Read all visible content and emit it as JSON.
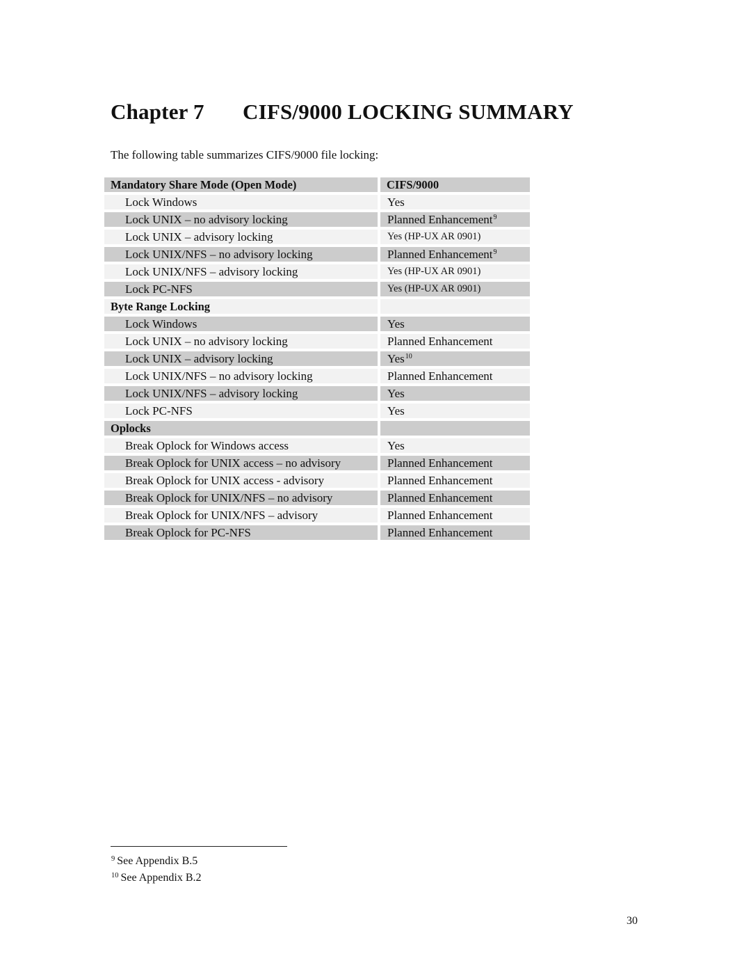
{
  "chapter": {
    "label": "Chapter 7",
    "title": "CIFS/9000 LOCKING SUMMARY"
  },
  "intro": "The following table summarizes CIFS/9000 file locking:",
  "table": {
    "header": {
      "feature": "Mandatory Share Mode (Open Mode)",
      "value": "CIFS/9000"
    },
    "rows": [
      {
        "feature": "Lock Windows",
        "value": "Yes",
        "note": ""
      },
      {
        "feature": "Lock UNIX – no advisory locking",
        "value": "Planned Enhancement",
        "note": "9"
      },
      {
        "feature": "Lock UNIX – advisory locking",
        "value": "Yes (HP-UX AR 0901)",
        "note": ""
      },
      {
        "feature": "Lock UNIX/NFS – no advisory locking",
        "value": "Planned Enhancement",
        "note": "9"
      },
      {
        "feature": "Lock UNIX/NFS – advisory locking",
        "value": "Yes (HP-UX AR 0901)",
        "note": ""
      },
      {
        "feature": "Lock PC-NFS",
        "value": "Yes (HP-UX AR 0901)",
        "note": ""
      },
      {
        "section": "Byte Range Locking"
      },
      {
        "feature": "Lock Windows",
        "value": "Yes",
        "note": ""
      },
      {
        "feature": "Lock UNIX – no advisory locking",
        "value": "Planned Enhancement",
        "note": ""
      },
      {
        "feature": "Lock UNIX – advisory locking",
        "value": "Yes",
        "note": "10"
      },
      {
        "feature": "Lock UNIX/NFS – no advisory locking",
        "value": "Planned Enhancement",
        "note": ""
      },
      {
        "feature": "Lock UNIX/NFS – advisory locking",
        "value": "Yes",
        "note": ""
      },
      {
        "feature": "Lock PC-NFS",
        "value": "Yes",
        "note": ""
      },
      {
        "section": "Oplocks"
      },
      {
        "feature": "Break Oplock for Windows access",
        "value": "Yes",
        "note": ""
      },
      {
        "feature": "Break Oplock for UNIX access – no advisory",
        "value": "Planned Enhancement",
        "note": ""
      },
      {
        "feature": "Break Oplock for UNIX access - advisory",
        "value": "Planned Enhancement",
        "note": ""
      },
      {
        "feature": "Break Oplock for UNIX/NFS – no advisory",
        "value": "Planned Enhancement",
        "note": ""
      },
      {
        "feature": "Break Oplock for UNIX/NFS – advisory",
        "value": "Planned Enhancement",
        "note": ""
      },
      {
        "feature": "Break Oplock for PC-NFS",
        "value": "Planned Enhancement",
        "note": ""
      }
    ]
  },
  "footnotes": [
    {
      "mark": "9",
      "text": "See Appendix B.5"
    },
    {
      "mark": "10",
      "text": "See Appendix B.2"
    }
  ],
  "page_number": "30"
}
